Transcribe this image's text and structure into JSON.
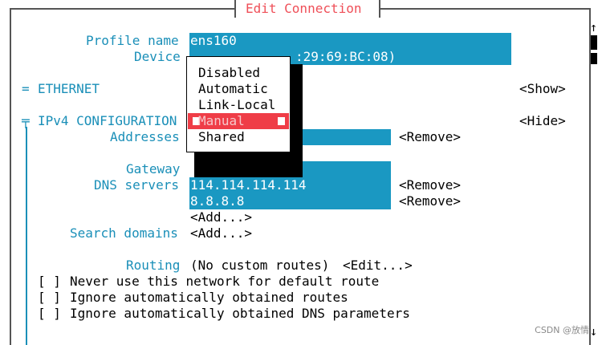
{
  "window": {
    "title": "Edit Connection"
  },
  "profile": {
    "label": "Profile name",
    "value": "ens160"
  },
  "device": {
    "label": "Device",
    "value_suffix": ":29:69:BC:08)"
  },
  "ethernet": {
    "marker": "=",
    "label": "ETHERNET",
    "action": "<Show>"
  },
  "ipv4": {
    "marker": "╤",
    "label": "IPv4 CONFIGURATION",
    "action": "<Hide>",
    "addresses_label": "Addresses",
    "addresses_remove": "<Remove>",
    "gateway_label": "Gateway",
    "dns_label": "DNS servers",
    "dns": [
      {
        "value": "114.114.114.114",
        "remove": "<Remove>"
      },
      {
        "value": "8.8.8.8",
        "remove": "<Remove>"
      }
    ],
    "dns_add": "<Add...>",
    "search_label": "Search domains",
    "search_add": "<Add...>",
    "routing_label": "Routing",
    "routing_value": "(No custom routes)",
    "routing_edit": "<Edit...>",
    "checkboxes": [
      {
        "box": "[ ]",
        "label": "Never use this network for default route"
      },
      {
        "box": "[ ]",
        "label": "Ignore automatically obtained routes"
      },
      {
        "box": "[ ]",
        "label": "Ignore automatically obtained DNS parameters"
      }
    ]
  },
  "dropdown": {
    "options": [
      "Disabled",
      "Automatic",
      "Link-Local",
      "Manual",
      "Shared"
    ],
    "selected_index": 3,
    "selected_color": "#ef3d47"
  },
  "scroll": {
    "up": "↑",
    "down": "↓"
  },
  "watermark": "CSDN @放情",
  "colors": {
    "accent": "#1a98c2",
    "title": "#ef4f58"
  }
}
